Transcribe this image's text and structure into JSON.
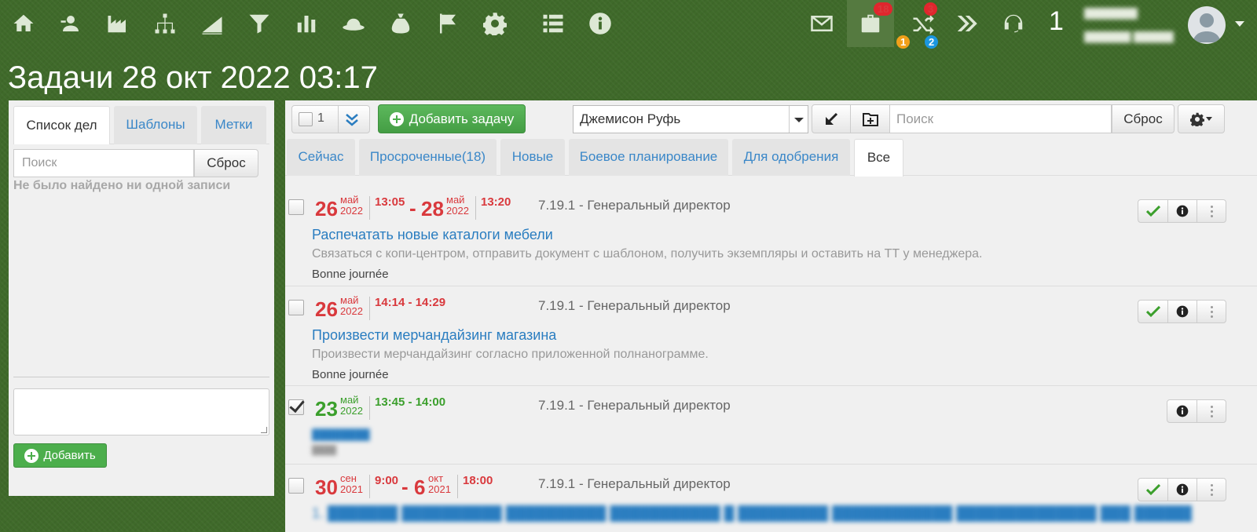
{
  "nav": {
    "icons": [
      "home-icon",
      "add-contact-icon",
      "factory-icon",
      "org-chart-icon",
      "sales-chart-icon",
      "filter-icon",
      "bar-chart-icon",
      "hat-icon",
      "money-bag-icon",
      "flag-icon",
      "gear-icon",
      "list-icon",
      "info-icon"
    ],
    "mail_icon": "mail-icon",
    "tasks_badge": "18",
    "routes_badge_top": "3",
    "badge_orange": "1",
    "badge_blue": "2",
    "counter": "1",
    "user_name_line1": "████████",
    "user_name_line2": "███████ ██████"
  },
  "page": {
    "title": "Задачи 28 окт 2022 03:17"
  },
  "left": {
    "tabs": [
      "Список дел",
      "Шаблоны",
      "Метки"
    ],
    "search_placeholder": "Поиск",
    "reset_label": "Сброс",
    "empty_text": "Не было найдено ни одной записи",
    "add_label": "Добавить"
  },
  "toolbar": {
    "selected_count": "1",
    "add_task_label": "Добавить задачу",
    "user_select": "Джемисон Руфь",
    "search_placeholder": "Поиск",
    "reset_label": "Сброс"
  },
  "tabs": [
    "Сейчас",
    "Просроченные(18)",
    "Новые",
    "Боевое планирование",
    "Для одобрения",
    "Все"
  ],
  "tasks": [
    {
      "start_day": "26",
      "start_month": "май",
      "start_year": "2022",
      "start_time": "13:05",
      "end_day": "28",
      "end_month": "май",
      "end_year": "2022",
      "end_time": "13:20",
      "assignee": "7.19.1 - Генеральный директор",
      "title": "Распечатать новые каталоги мебели",
      "description": "Связаться с копи-центром, отправить документ с шаблоном, получить экземпляры и оставить на ТТ у менеджера.",
      "note": "Bonne journée",
      "status": "overdue",
      "checked": false
    },
    {
      "start_day": "26",
      "start_month": "май",
      "start_year": "2022",
      "time_range": "14:14 - 14:29",
      "assignee": "7.19.1 - Генеральный директор",
      "title": "Произвести мерчандайзинг магазина",
      "description": "Произвести мерчандайзинг согласно приложенной полнанограмме.",
      "note": "Bonne journée",
      "status": "overdue",
      "checked": false
    },
    {
      "start_day": "23",
      "start_month": "май",
      "start_year": "2022",
      "time_range": "13:45 - 14:00",
      "assignee": "7.19.1 - Генеральный директор",
      "title": "████████",
      "description": "████",
      "status": "done",
      "checked": true
    },
    {
      "start_day": "30",
      "start_month": "сен",
      "start_year": "2021",
      "start_time": "9:00",
      "end_day": "6",
      "end_month": "окт",
      "end_year": "2021",
      "end_time": "18:00",
      "assignee": "7.19.1 - Генеральный директор",
      "title": "1. ███████ ██████████ ██████████ ███████████ █ █████████ ████████████ ██████████████ ███ ████████████ ████████████ ████ ███ ██████ ██",
      "status": "overdue",
      "checked": false
    }
  ],
  "colors": {
    "overdue": "#d9393d",
    "done": "#3b9f2c",
    "link": "#2a7dc0",
    "brand_green": "#3f6a2a"
  }
}
